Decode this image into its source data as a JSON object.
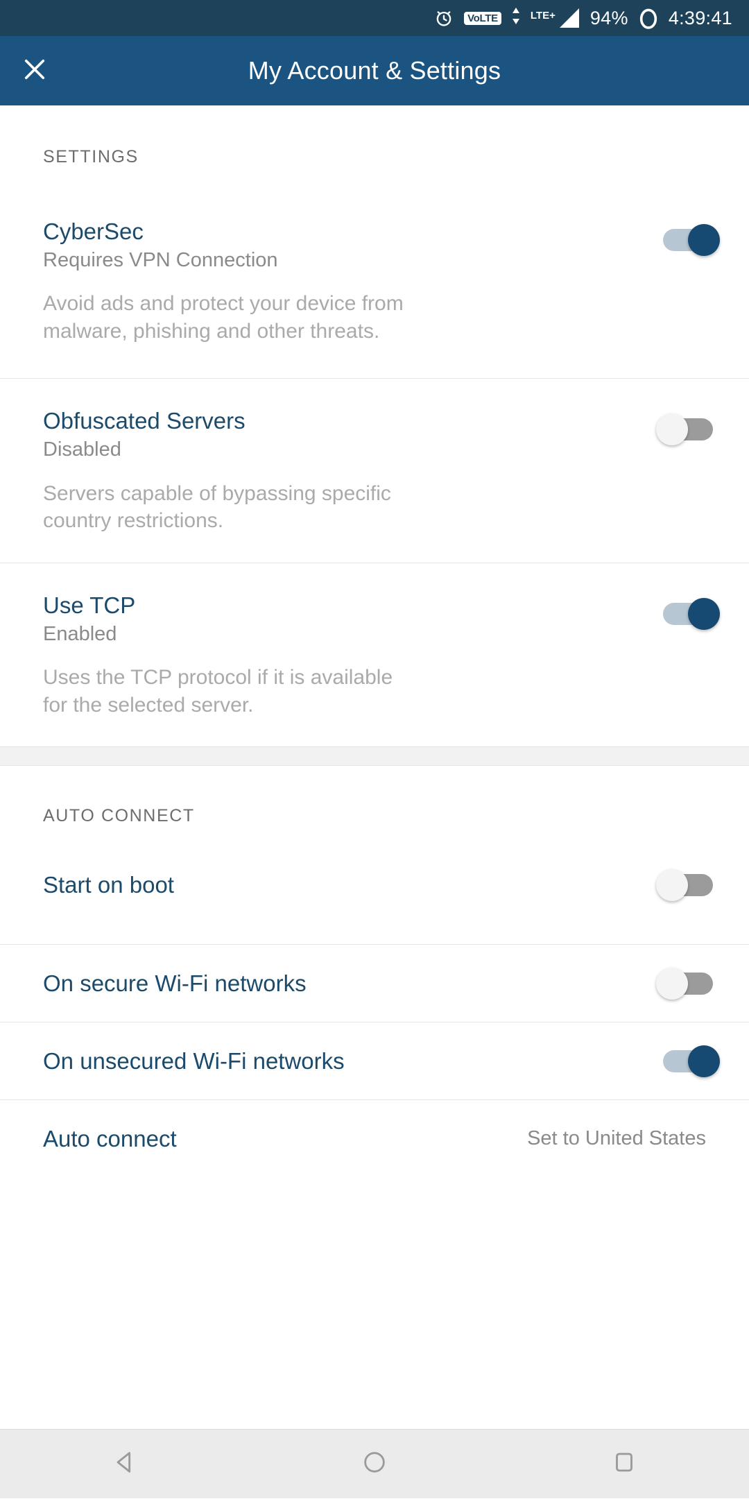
{
  "statusbar": {
    "alarm_icon": "alarm-clock-icon",
    "volte_label": "VoLTE",
    "network_label": "LTE+",
    "battery_percent": "94%",
    "battery_icon": "battery-circle-icon",
    "time": "4:39:41"
  },
  "appbar": {
    "close_icon": "close-icon",
    "title": "My Account & Settings"
  },
  "sections": [
    {
      "header": "SETTINGS",
      "rows": [
        {
          "title": "CyberSec",
          "status": "Requires VPN Connection",
          "description": "Avoid ads and protect your device from malware, phishing and other threats.",
          "toggle": "on"
        },
        {
          "title": "Obfuscated Servers",
          "status": "Disabled",
          "description": "Servers capable of bypassing specific country restrictions.",
          "toggle": "off"
        },
        {
          "title": "Use TCP",
          "status": "Enabled",
          "description": "Uses the TCP protocol if it is available for the selected server.",
          "toggle": "on"
        }
      ]
    },
    {
      "header": "AUTO CONNECT",
      "rows": [
        {
          "title": "Start on boot",
          "toggle": "off"
        },
        {
          "title": "On secure Wi-Fi networks",
          "toggle": "off"
        },
        {
          "title": "On unsecured Wi-Fi networks",
          "toggle": "on"
        },
        {
          "title": "Auto connect",
          "value": "Set to United States"
        }
      ]
    }
  ],
  "navbar": {
    "back_icon": "back-triangle-icon",
    "home_icon": "home-circle-icon",
    "recents_icon": "recents-square-icon"
  },
  "colors": {
    "status_bar": "#1d4259",
    "app_bar": "#1b5480",
    "title_text": "#1b4a6b",
    "toggle_on_thumb": "#174a72",
    "toggle_on_track": "#b6c6d3",
    "toggle_off_track": "#9b9b9b"
  }
}
